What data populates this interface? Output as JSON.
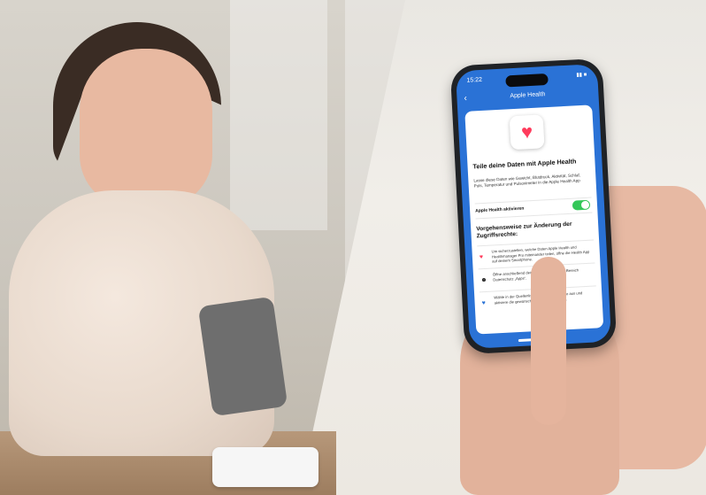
{
  "phone": {
    "status_time": "15:22",
    "status_icons": "▮▮ ■",
    "nav_back": "‹",
    "nav_title": "Apple Health",
    "heading": "Teile deine Daten mit Apple Health",
    "description": "Lasse diese Daten wie Gewicht, Blutdruck, Aktivität, Schlaf, Puls, Temperatur und Pulsoxi­meter in die Apple Health App",
    "toggle_label": "Apple Health aktivieren",
    "toggle_on": true,
    "subheading": "Vorgehensweise zur Änderung der Zugriffsrechte:",
    "steps": [
      {
        "icon": "♥",
        "text": "Um sicherzustellen, welche Daten Apple Health und Healthmanager Pro miteinander teilen, öffne die Health App auf deinem Smartphone."
      },
      {
        "icon": "☻",
        "text": "Öffne anschließend dein Profil und wähle im Bereich Datenschutz „Apps“."
      },
      {
        "icon": "♥",
        "text": "Wähle in der Quellenliste Healthmanager Pro aus und aktiviere die gewünschten Freigaben für die."
      }
    ]
  },
  "colors": {
    "screen_blue": "#2a72d6",
    "toggle_green": "#34c759",
    "heart_red": "#ff3b5c"
  }
}
